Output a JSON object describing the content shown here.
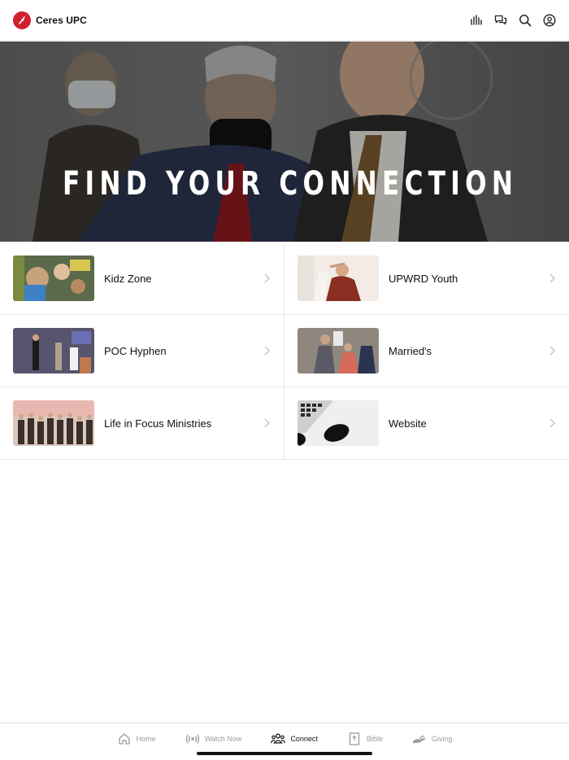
{
  "app": {
    "title": "Ceres UPC",
    "brand_color": "#d01f2e"
  },
  "header_icons": [
    "audio-bars-icon",
    "chat-bubbles-icon",
    "search-icon",
    "profile-icon"
  ],
  "hero": {
    "title": "FIND YOUR CONNECTION"
  },
  "items": [
    {
      "label": "Kidz Zone",
      "thumb": "kids-group-photo"
    },
    {
      "label": "UPWRD Youth",
      "thumb": "youth-prayer-photo"
    },
    {
      "label": "POC Hyphen",
      "thumb": "stage-speakers-photo"
    },
    {
      "label": "Married's",
      "thumb": "couples-photo"
    },
    {
      "label": "Life in Focus Ministries",
      "thumb": "congregation-photo"
    },
    {
      "label": "Website",
      "thumb": "keyboard-mouse-photo"
    }
  ],
  "tabs": [
    {
      "label": "Home",
      "icon": "home-icon",
      "active": false
    },
    {
      "label": "Watch Now",
      "icon": "broadcast-icon",
      "active": false
    },
    {
      "label": "Connect",
      "icon": "people-icon",
      "active": true
    },
    {
      "label": "Bible",
      "icon": "bible-icon",
      "active": false
    },
    {
      "label": "Giving",
      "icon": "giving-hand-icon",
      "active": false
    }
  ]
}
